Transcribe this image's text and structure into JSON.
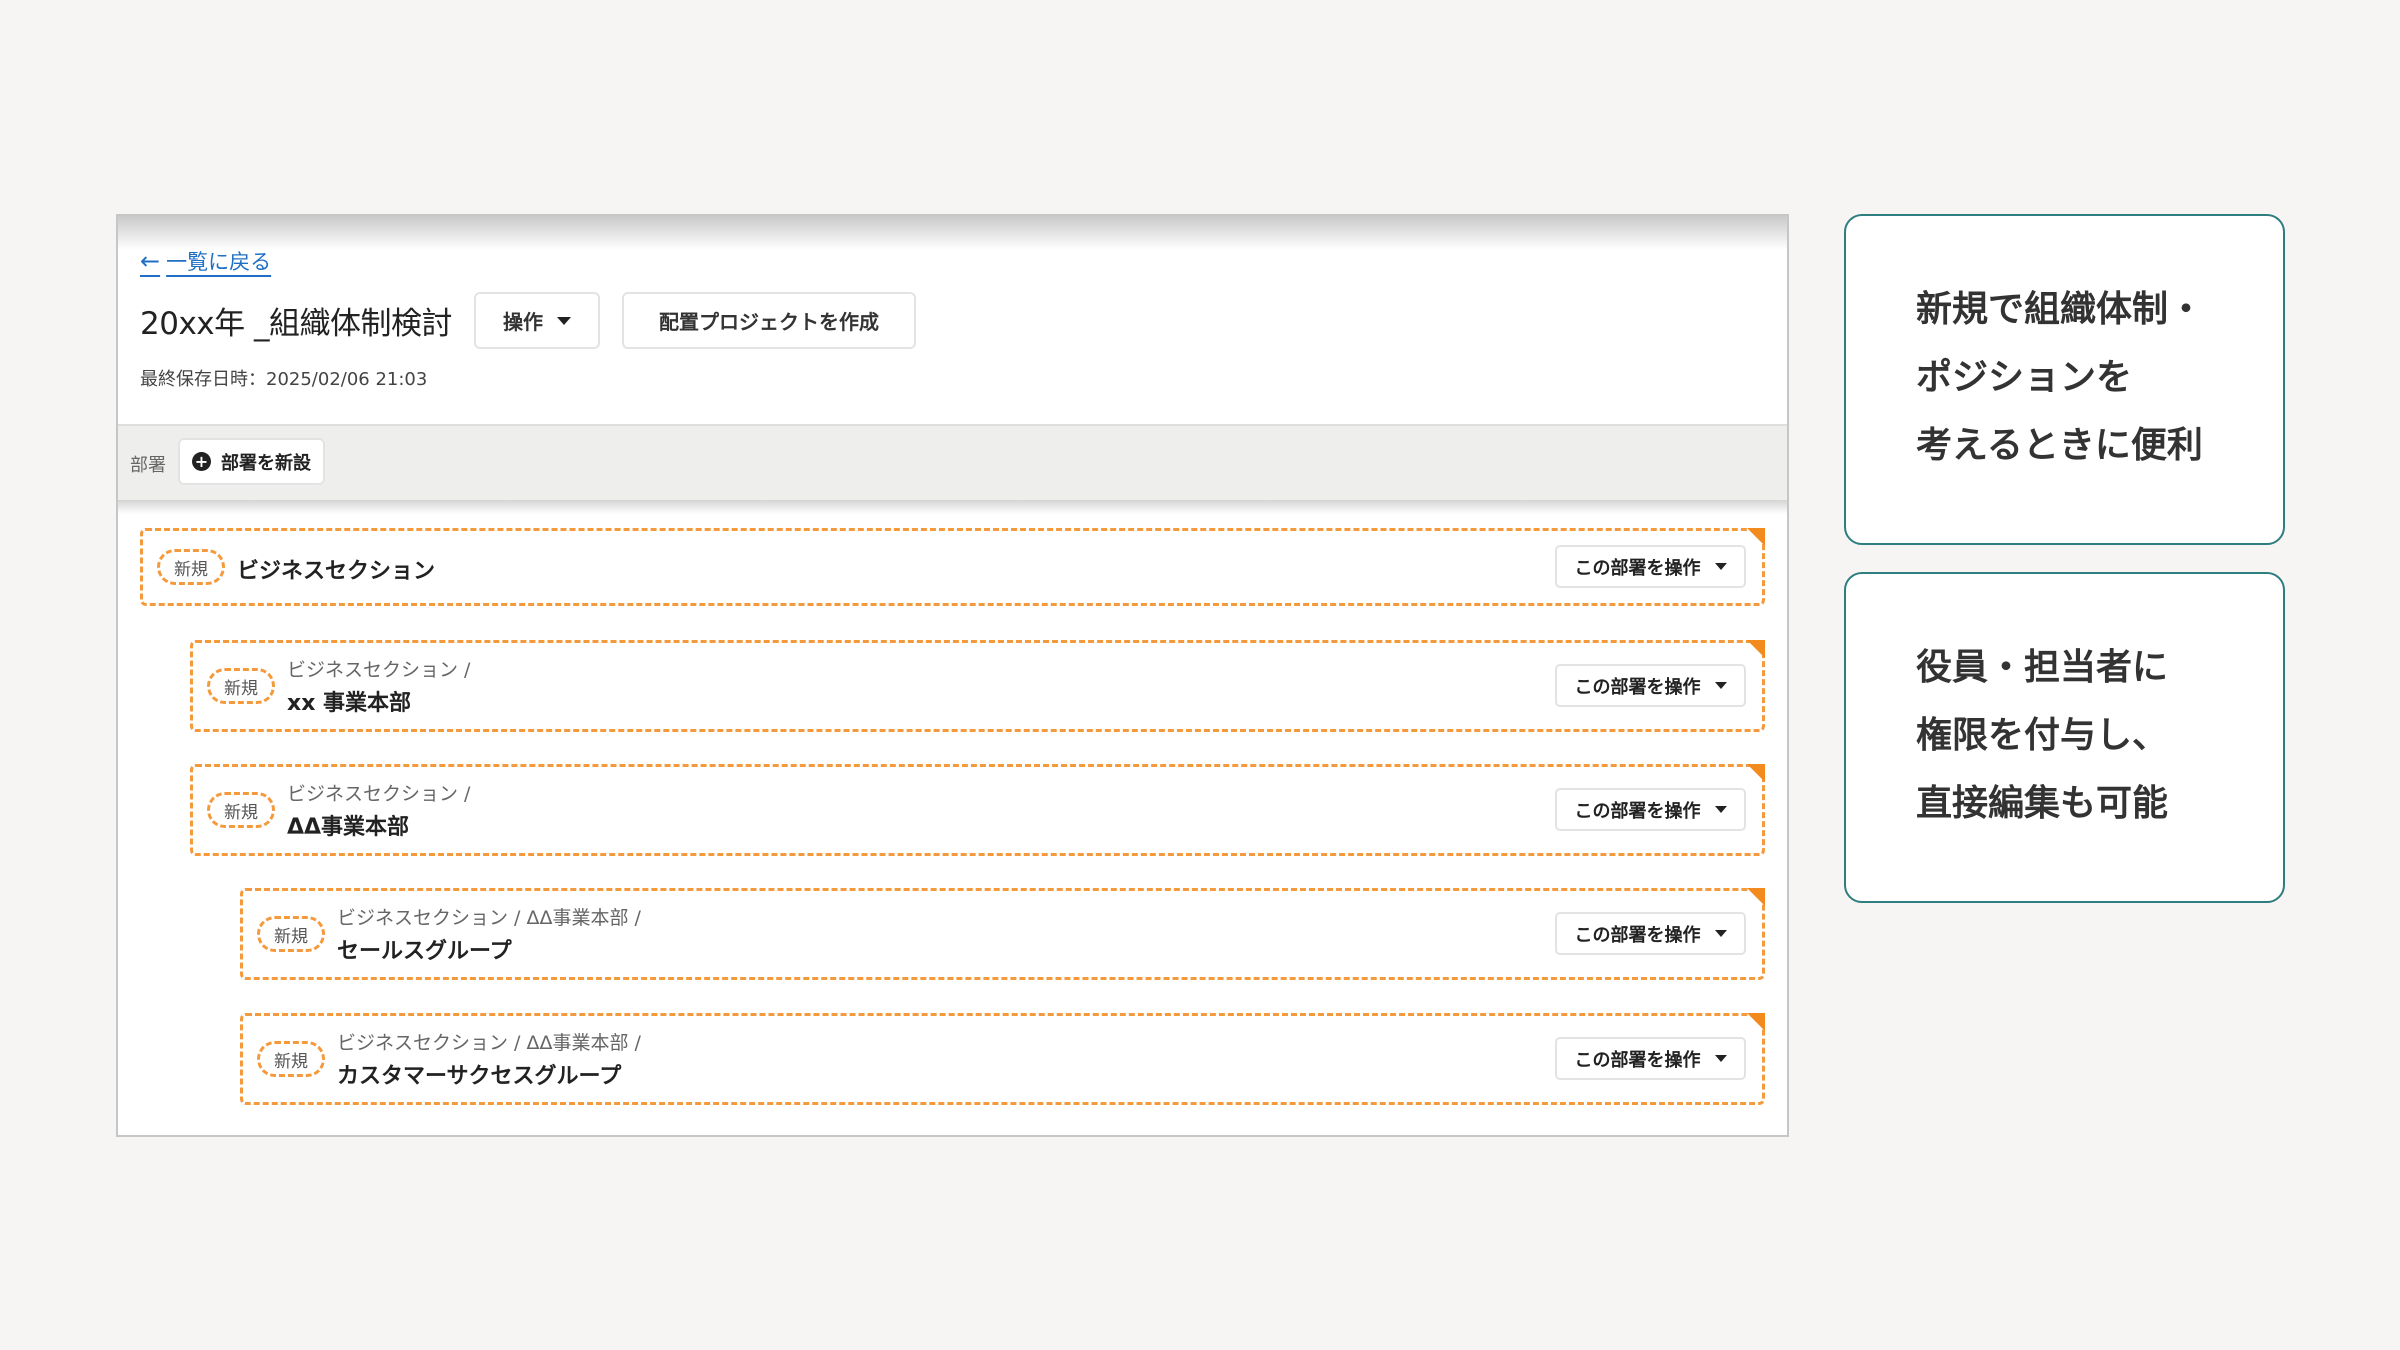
{
  "header": {
    "back_link": "一覧に戻る",
    "title": "20xx年 _組織体制検討",
    "operations_button": "操作",
    "create_project_button": "配置プロジェクトを作成",
    "last_saved": "最終保存日時：2025/02/06 21:03"
  },
  "toolbar": {
    "label": "部署",
    "new_department_button": "部署を新設"
  },
  "departments": [
    {
      "badge": "新規",
      "path": "",
      "name": "ビジネスセクション",
      "action": "この部署を操作"
    },
    {
      "badge": "新規",
      "path": "ビジネスセクション /",
      "name": "xx 事業本部",
      "action": "この部署を操作"
    },
    {
      "badge": "新規",
      "path": "ビジネスセクション /",
      "name": "ΔΔ事業本部",
      "action": "この部署を操作"
    },
    {
      "badge": "新規",
      "path": "ビジネスセクション / ΔΔ事業本部 /",
      "name": "セールスグループ",
      "action": "この部署を操作"
    },
    {
      "badge": "新規",
      "path": "ビジネスセクション / ΔΔ事業本部 /",
      "name": "カスタマーサクセスグループ",
      "action": "この部署を操作"
    }
  ],
  "callouts": [
    {
      "lines": [
        "新規で組織体制・",
        "ポジションを",
        "考えるときに便利"
      ]
    },
    {
      "lines": [
        "役員・担当者に",
        "権限を付与し、",
        "直接編集も可能"
      ]
    }
  ],
  "colors": {
    "accent_orange": "#f59a3c",
    "link_blue": "#1f6fc4",
    "callout_border": "#2e7d7f"
  },
  "icons": {
    "back": "arrow-left-icon",
    "dropdown": "caret-down-icon",
    "add": "plus-circle-icon"
  }
}
